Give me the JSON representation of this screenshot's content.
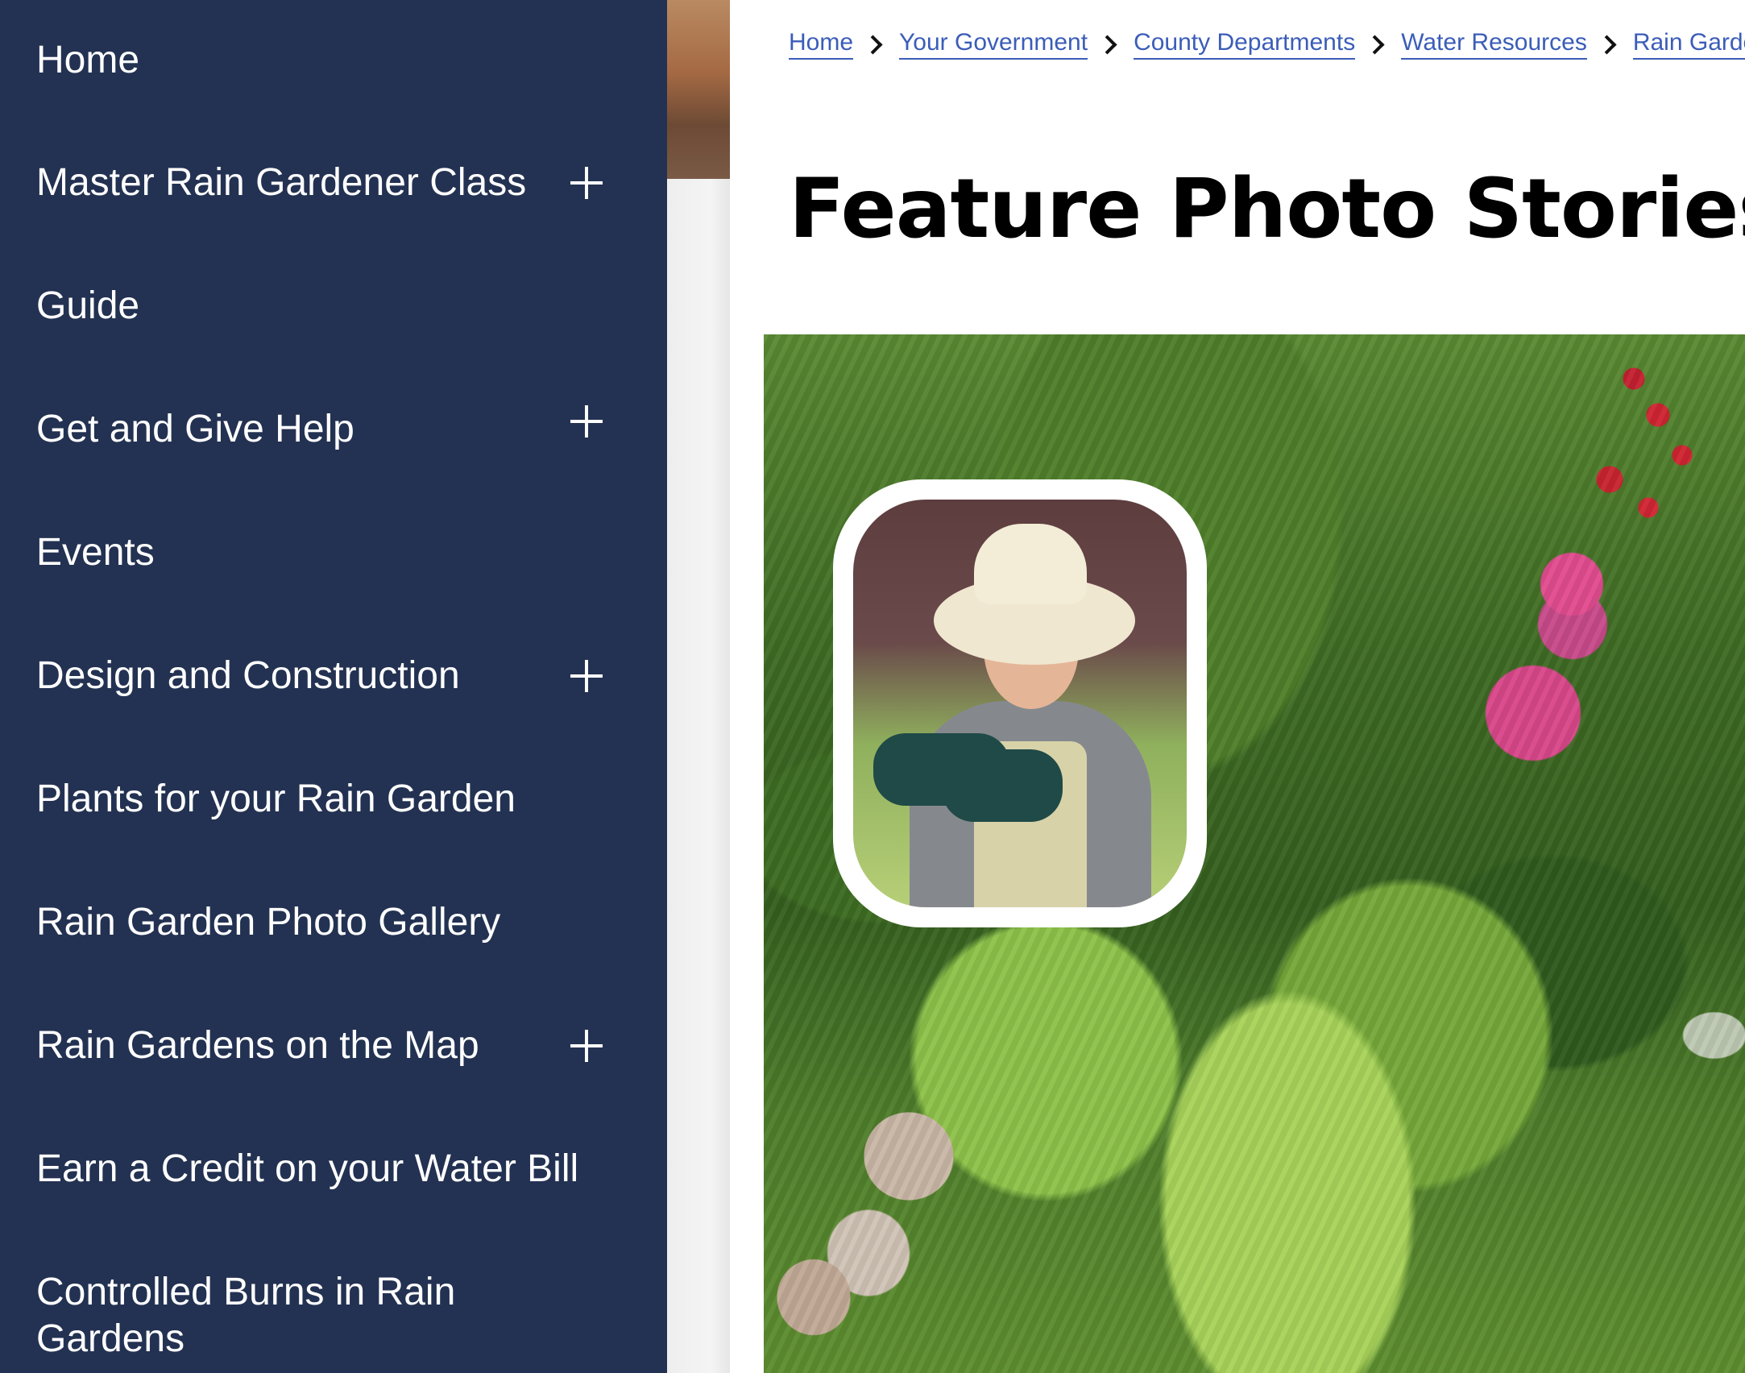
{
  "colors": {
    "sidebar_bg": "#233252",
    "sidebar_text": "#ffffff",
    "link": "#3b5db8",
    "title": "#000000"
  },
  "sidebar": {
    "items": [
      {
        "label": "Home",
        "expandable": false
      },
      {
        "label": "Master Rain Gardener Class",
        "expandable": true,
        "icon": "plus-icon"
      },
      {
        "label": "Guide",
        "expandable": false
      },
      {
        "label": "Get and Give Help",
        "expandable": true,
        "icon": "plus-icon"
      },
      {
        "label": "Events",
        "expandable": false
      },
      {
        "label": "Design and Construction",
        "expandable": true,
        "icon": "plus-icon"
      },
      {
        "label": "Plants for your Rain Garden",
        "expandable": false
      },
      {
        "label": "Rain Garden Photo Gallery",
        "expandable": false
      },
      {
        "label": "Rain Gardens on the Map",
        "expandable": true,
        "icon": "plus-icon"
      },
      {
        "label": "Earn a Credit on your Water Bill",
        "expandable": false
      },
      {
        "label": "Controlled Burns in Rain Gardens",
        "expandable": false
      }
    ]
  },
  "breadcrumb": [
    {
      "label": "Home"
    },
    {
      "label": "Your Government"
    },
    {
      "label": "County Departments"
    },
    {
      "label": "Water Resources"
    },
    {
      "label": "Rain Gardens"
    }
  ],
  "breadcrumb_separator_icon": "chevron-right-icon",
  "main": {
    "title": "Feature Photo Stories",
    "feature_image": {
      "description_icon": "garden-photo",
      "portrait_icon": "gardener-portrait"
    }
  }
}
